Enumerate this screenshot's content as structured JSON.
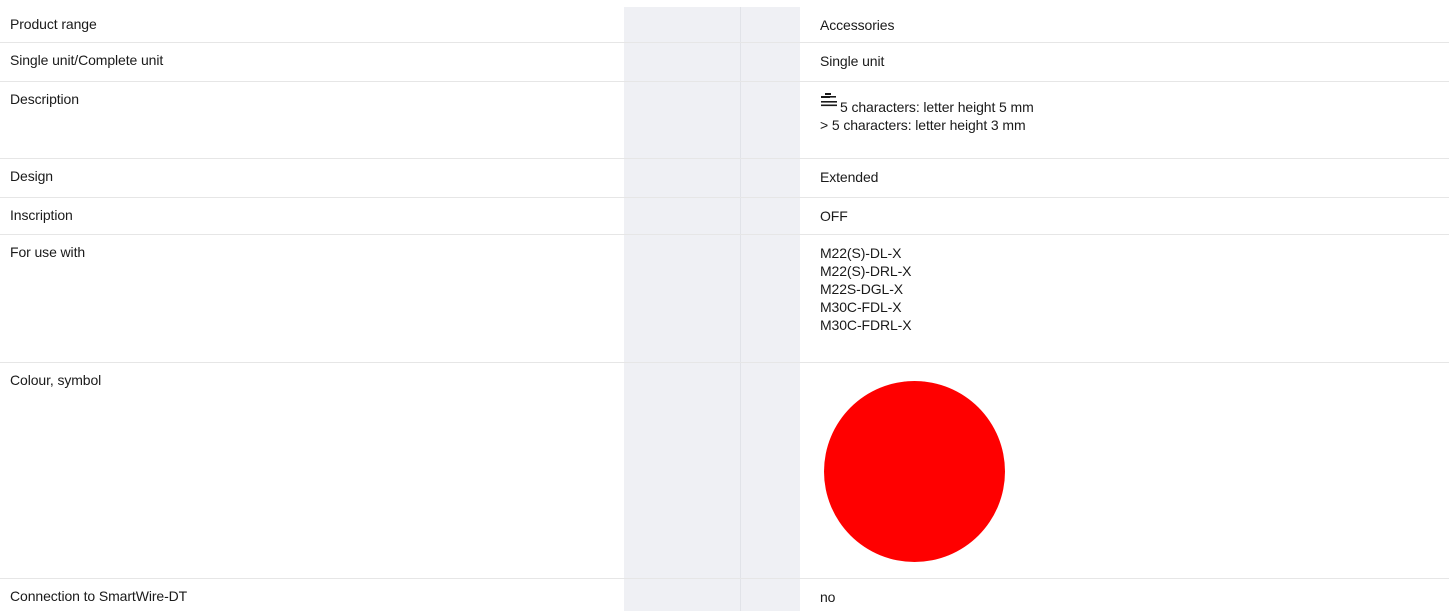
{
  "rows": [
    {
      "label": "Product range",
      "value": "Accessories"
    },
    {
      "label": "Single unit/Complete unit",
      "value": "Single unit"
    },
    {
      "label": "Description",
      "icon": "text-length-icon",
      "lines": [
        "5 characters: letter height 5 mm",
        "> 5 characters: letter height 3 mm"
      ]
    },
    {
      "label": "Design",
      "value": "Extended"
    },
    {
      "label": "Inscription",
      "value": "OFF"
    },
    {
      "label": "For use with",
      "lines": [
        "M22(S)-DL-X",
        "M22(S)-DRL-X",
        "M22S-DGL-X",
        "M30C-FDL-X",
        "M30C-FDRL-X"
      ]
    },
    {
      "label": "Colour, symbol",
      "swatch_color": "#ff0000"
    },
    {
      "label": "Connection to SmartWire-DT",
      "value": "no"
    }
  ],
  "colors": {
    "shaded_column": "#eff0f4",
    "row_divider": "#e6e6e6",
    "link_blue": "#1e6fd9",
    "swatch_red": "#ff0000"
  }
}
